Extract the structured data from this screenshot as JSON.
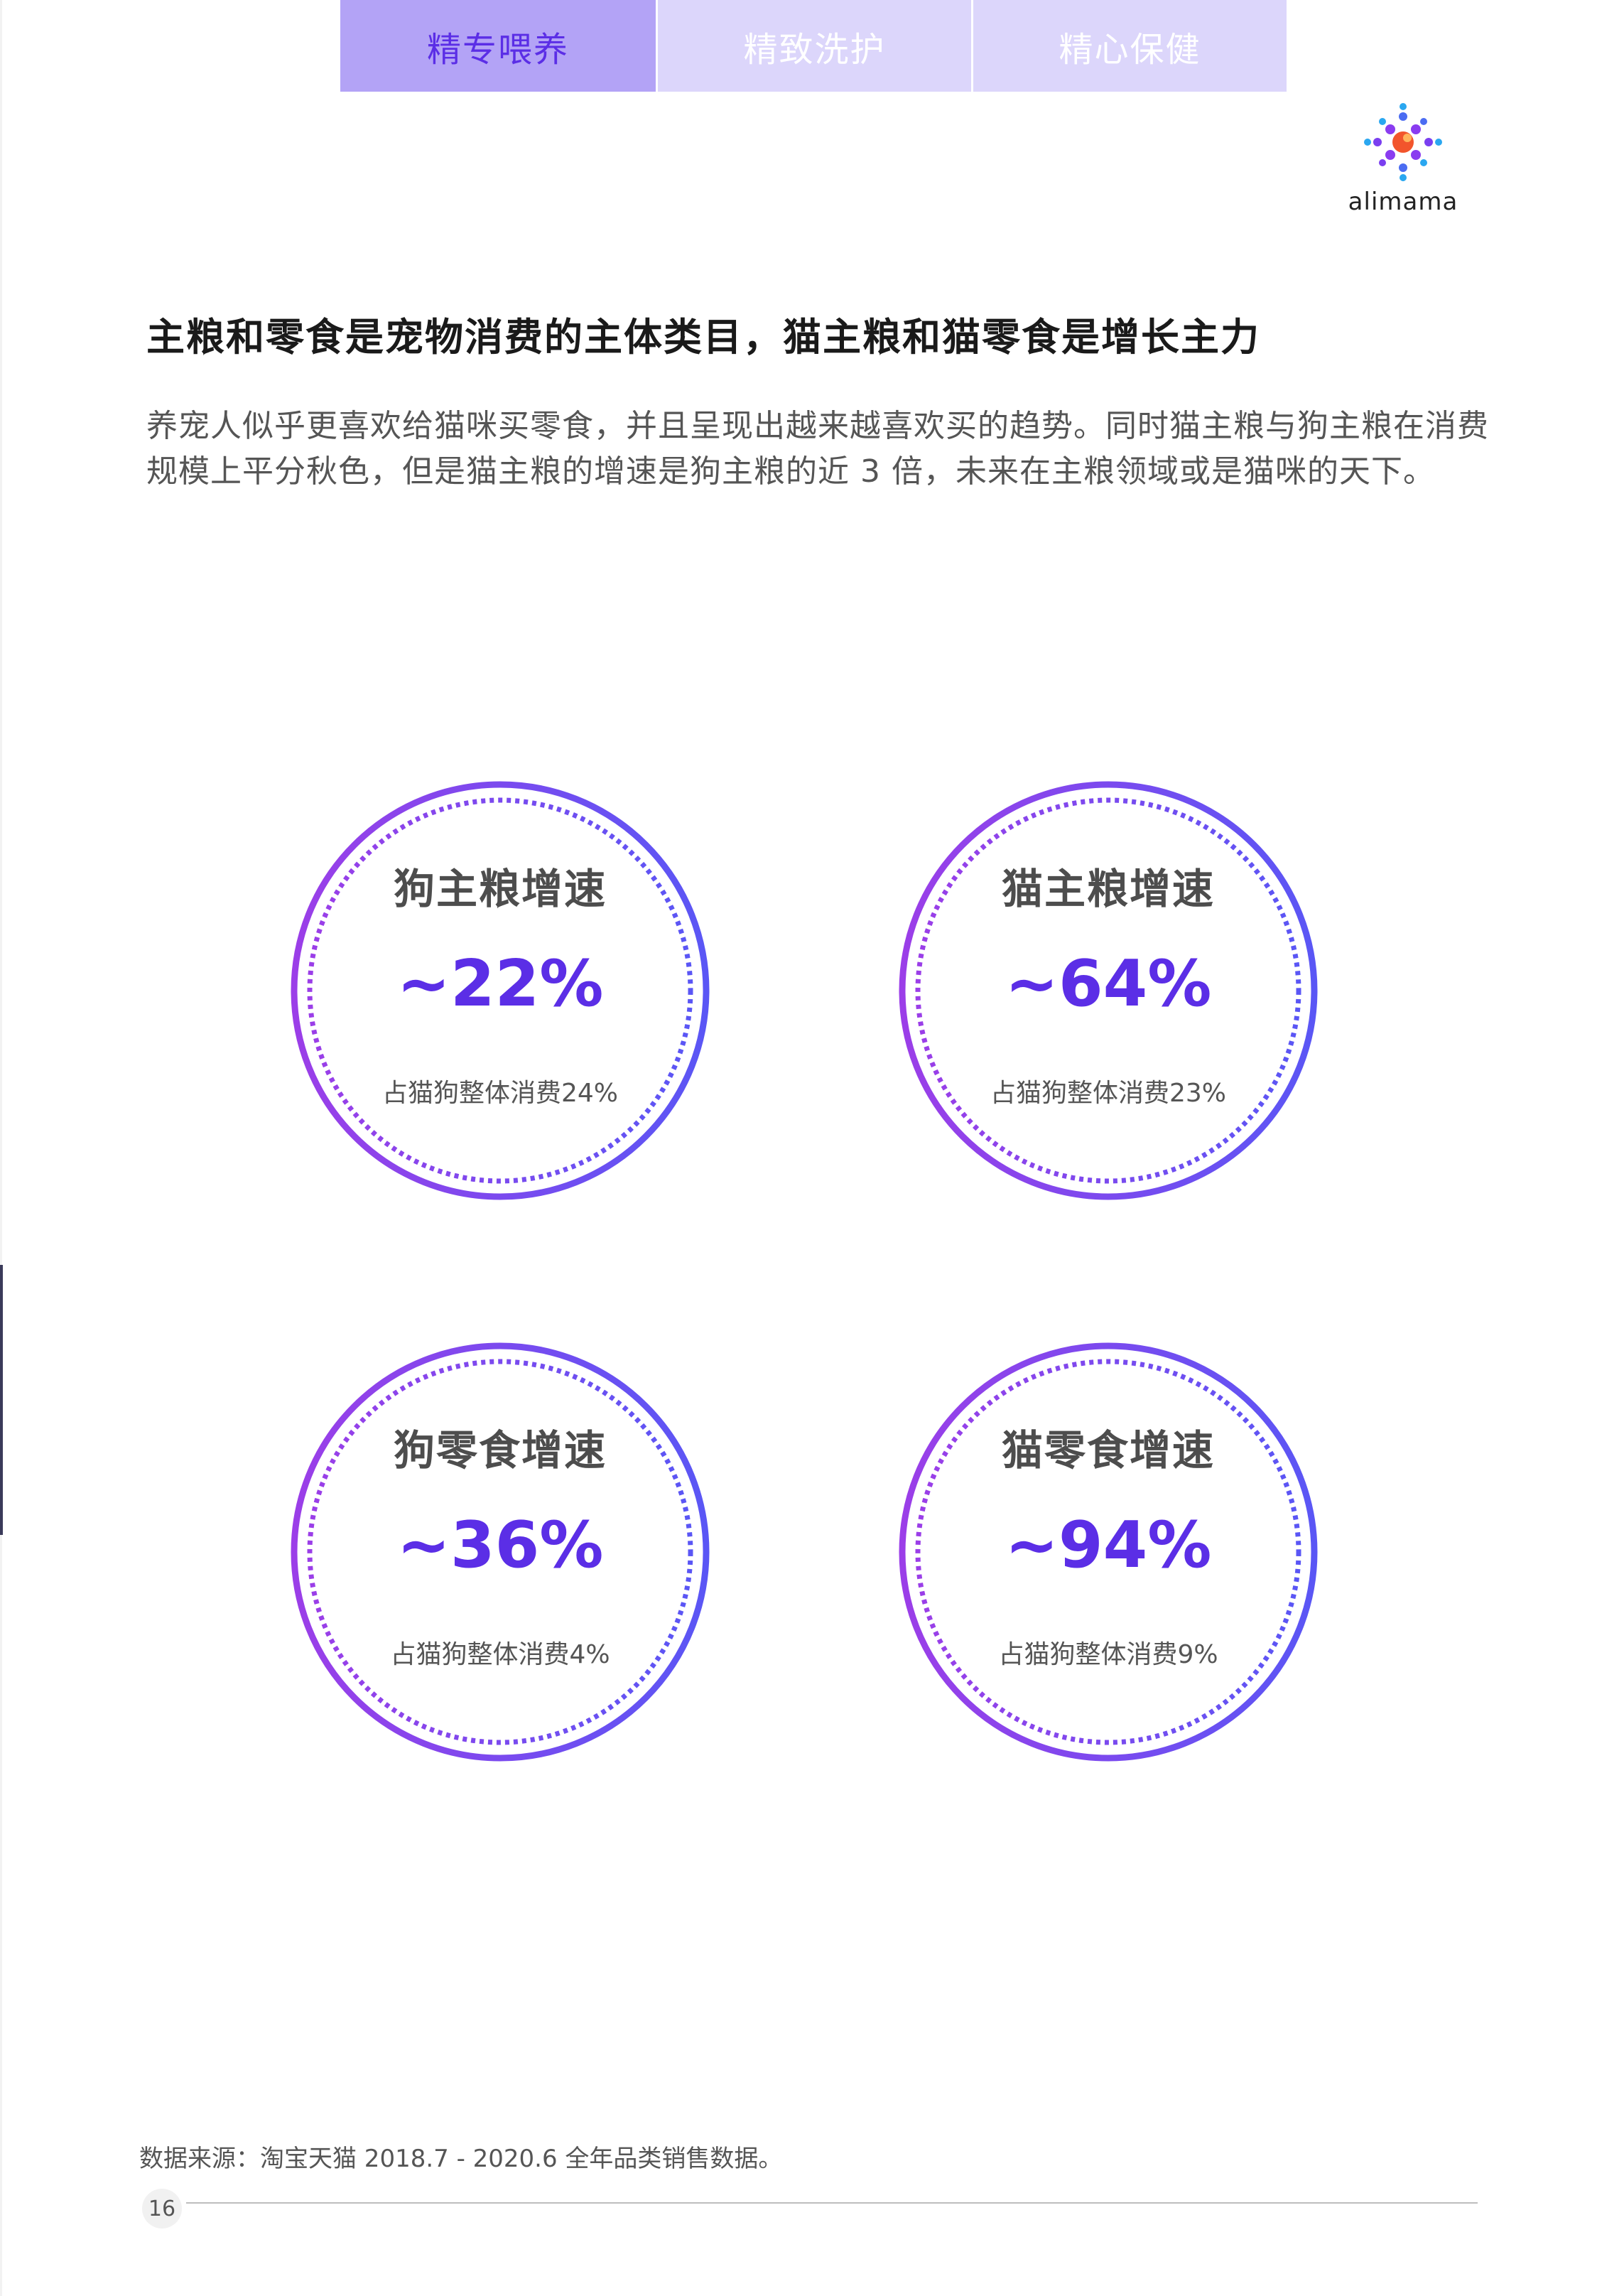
{
  "tabs": [
    {
      "label": "精专喂养",
      "active": true
    },
    {
      "label": "精致洗护",
      "active": false
    },
    {
      "label": "精心保健",
      "active": false
    }
  ],
  "logo": {
    "text": "alimama"
  },
  "heading": "主粮和零食是宠物消费的主体类目，猫主粮和猫零食是增长主力",
  "intro": "养宠人似乎更喜欢给猫咪买零食，并且呈现出越来越喜欢买的趋势。同时猫主粮与狗主粮在消费规模上平分秋色，但是猫主粮的增速是狗主粮的近 3 倍，未来在主粮领域或是猫咪的天下。",
  "stats": [
    {
      "label": "狗主粮增速",
      "value": "~22%",
      "share": "占猫狗整体消费24%"
    },
    {
      "label": "猫主粮增速",
      "value": "~64%",
      "share": "占猫狗整体消费23%"
    },
    {
      "label": "狗零食增速",
      "value": "~36%",
      "share": "占猫狗整体消费4%"
    },
    {
      "label": "猫零食增速",
      "value": "~94%",
      "share": "占猫狗整体消费9%"
    }
  ],
  "footer": {
    "source": "数据来源：淘宝天猫 2018.7 - 2020.6 全年品类销售数据。",
    "page_number": "16"
  },
  "colors": {
    "accent": "#5b2ee6",
    "ring_start": "#9b3ee8",
    "ring_end": "#5a56f5",
    "tab_active_bg": "#b3a3f6",
    "tab_inactive_bg": "#dcd6fb"
  }
}
